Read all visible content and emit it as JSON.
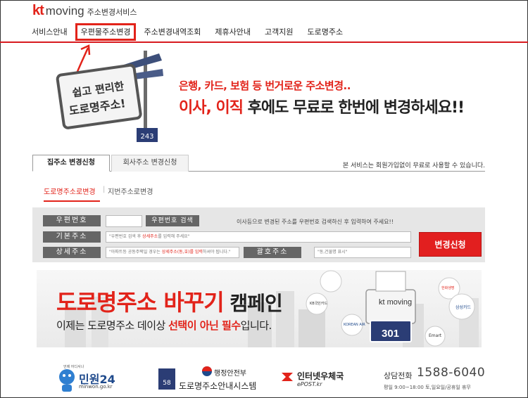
{
  "brand": {
    "logo_kt": "kt",
    "logo_moving": "moving",
    "service_name": "주소변경서비스"
  },
  "nav": {
    "items": [
      {
        "label": "서비스안내"
      },
      {
        "label": "우편물주소변경",
        "highlighted": true
      },
      {
        "label": "주소변경내역조회"
      },
      {
        "label": "제휴사안내"
      },
      {
        "label": "고객지원"
      },
      {
        "label": "도로명주소"
      }
    ]
  },
  "banner": {
    "sign_text_1": "쉽고 편리한",
    "sign_text_2": "도로명주소!",
    "sign_number": "243",
    "tagline": "은행, 카드, 보험 등 번거로운 주소변경..",
    "headline_red": "이사, 이직",
    "headline_rest": " 후에도 무료로 한번에 변경하세요!!"
  },
  "tabs": [
    {
      "label": "집주소 변경신청",
      "active": true
    },
    {
      "label": "회사주소 변경신청",
      "active": false
    }
  ],
  "notice": "본 서비스는 회원가입없이 무료로 사용할 수 있습니다.",
  "subtabs": [
    {
      "label": "도로명주소로변경",
      "active": true
    },
    {
      "label": "지번주소로변경",
      "active": false
    }
  ],
  "form": {
    "zip_label": "우편번호",
    "zip_search_button": "우편번호 검색",
    "zip_note": "이사등으로 변경된 주소를 우편번호 검색하신 후 입력하여 주세요!!",
    "base_label": "기본주소",
    "base_placeholder_pre": "\"우편번호 검색 후 ",
    "base_placeholder_hl": "상세주소",
    "base_placeholder_post": "를 입력해 주세요\"",
    "detail_label": "상세주소",
    "detail_placeholder_pre": "\"아파트등 공동주택일 경우는 ",
    "detail_placeholder_hl": "상세주소(동,호)를 입력",
    "detail_placeholder_post": "하셔야 됩니다.\"",
    "extra_label": "괄호주소",
    "extra_placeholder": "\"동,건물명 표시\"",
    "submit_label": "변경신청"
  },
  "campaign": {
    "title_red": "도로명주소 바꾸기",
    "title_dark": " 캠페인",
    "sub_pre": "이제는 도로명주소 데이상 ",
    "sub_red": "선택이 아닌 필수",
    "sub_post": "입니다.",
    "printer_brand": "kt moving",
    "sign_number": "301",
    "partners": [
      "KB국민카드",
      "KOREAN AIR",
      "삼성카드",
      "Emart",
      "한화생명"
    ]
  },
  "footer": {
    "minwon_small": "언제 어디서나",
    "minwon_name": "민원24",
    "minwon_url": "minwon.go.kr",
    "road_org": "행정안전부",
    "road_name": "도로명주소안내시스템",
    "road_sign": "58",
    "post_name": "인터넷우체국",
    "post_url": "ePOST.kr",
    "call_label": "상담전화",
    "call_number": "1588-6040",
    "call_hours": "평일 9:00~18:00 토,일요일/공휴일 휴무"
  },
  "colors": {
    "brand_red": "#e2231a",
    "label_gray": "#666666",
    "form_bg": "#e6e6e6"
  }
}
